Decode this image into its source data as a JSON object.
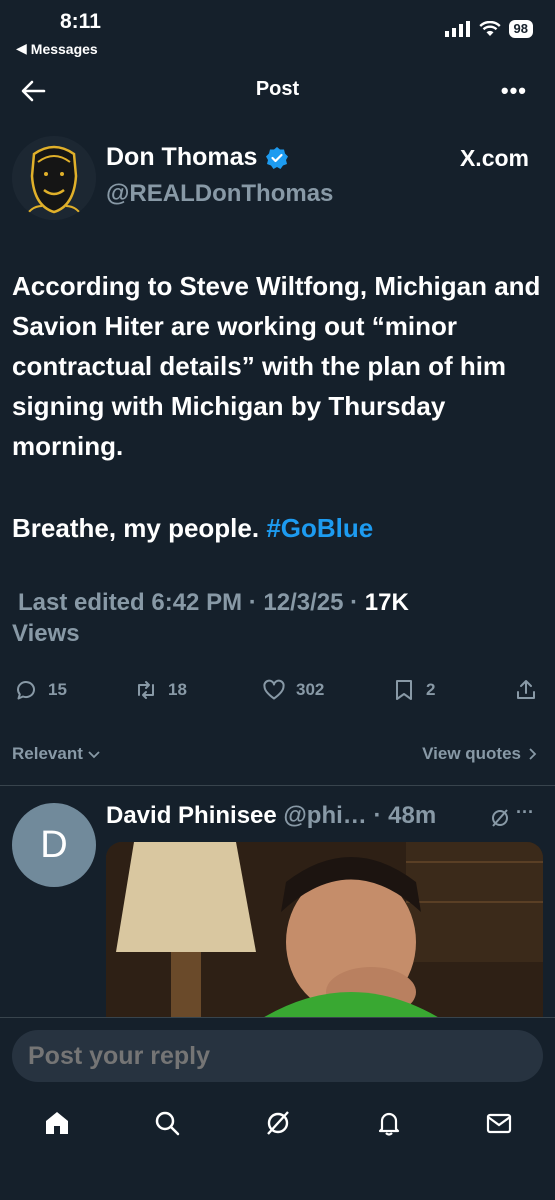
{
  "status_bar": {
    "time": "8:11",
    "back_label": "Messages",
    "battery": "98"
  },
  "header": {
    "title": "Post",
    "more": "•••"
  },
  "author": {
    "name": "Don Thomas",
    "handle": "@REALDonThomas",
    "source": "X.com",
    "verified": true
  },
  "tweet": {
    "text": "According to Steve Wiltfong, Michigan and Savion Hiter are working out “minor contractual details” with the plan of him signing with Michigan by Thursday morning.",
    "text2": "Breathe, my people.",
    "hashtag": "#GoBlue",
    "edited": "Last edited 6:42 PM · 12/3/25",
    "views_sep": " · ",
    "views_count": "17K",
    "views_label": "Views"
  },
  "actions": {
    "replies": "15",
    "reposts": "18",
    "likes": "302",
    "bookmarks": "2"
  },
  "filter": {
    "relevant": "Relevant",
    "view_quotes": "View quotes"
  },
  "reply": {
    "avatar_letter": "D",
    "name": "David Phinisee",
    "handle": "@phi…",
    "time": "· 48m"
  },
  "composer": {
    "placeholder": "Post your reply"
  },
  "colors": {
    "background": "#15202b",
    "accent": "#1d9bf0",
    "muted": "#8899a6"
  }
}
